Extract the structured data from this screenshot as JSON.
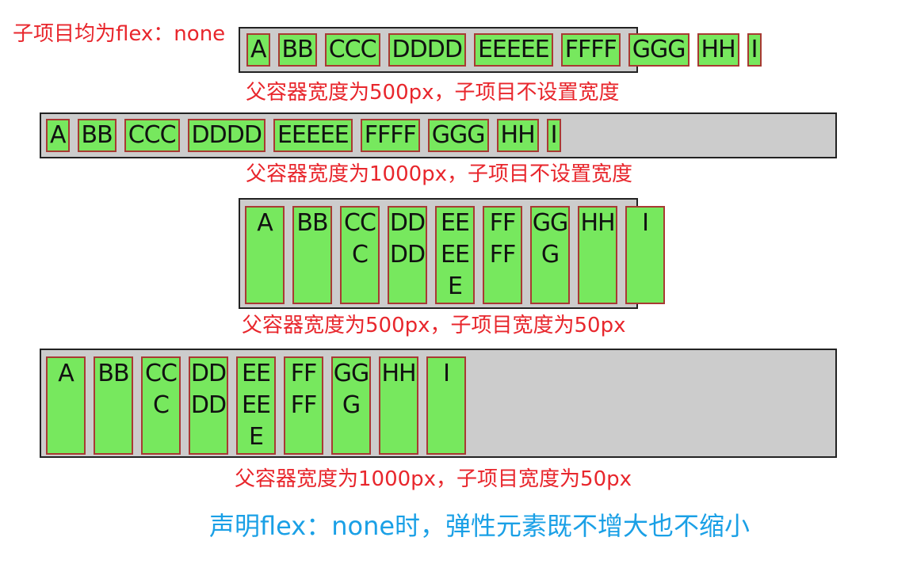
{
  "title": "子项目均为flex：none",
  "items": [
    "A",
    "BB",
    "CCC",
    "DDDD",
    "EEEEE",
    "FFFF",
    "GGG",
    "HH",
    "I"
  ],
  "captions": [
    "父容器宽度为500px，子项目不设置宽度",
    "父容器宽度为1000px，子项目不设置宽度",
    "父容器宽度为500px，子项目宽度为50px",
    "父容器宽度为1000px，子项目宽度为50px"
  ],
  "conclusion": "声明flex：none时，弹性元素既不增大也不缩小",
  "colors": {
    "label": "#e8262c",
    "conclusion": "#1aa0e6",
    "container": "#cccccc",
    "item_fill": "#77e85e",
    "item_border": "#a83a33"
  }
}
